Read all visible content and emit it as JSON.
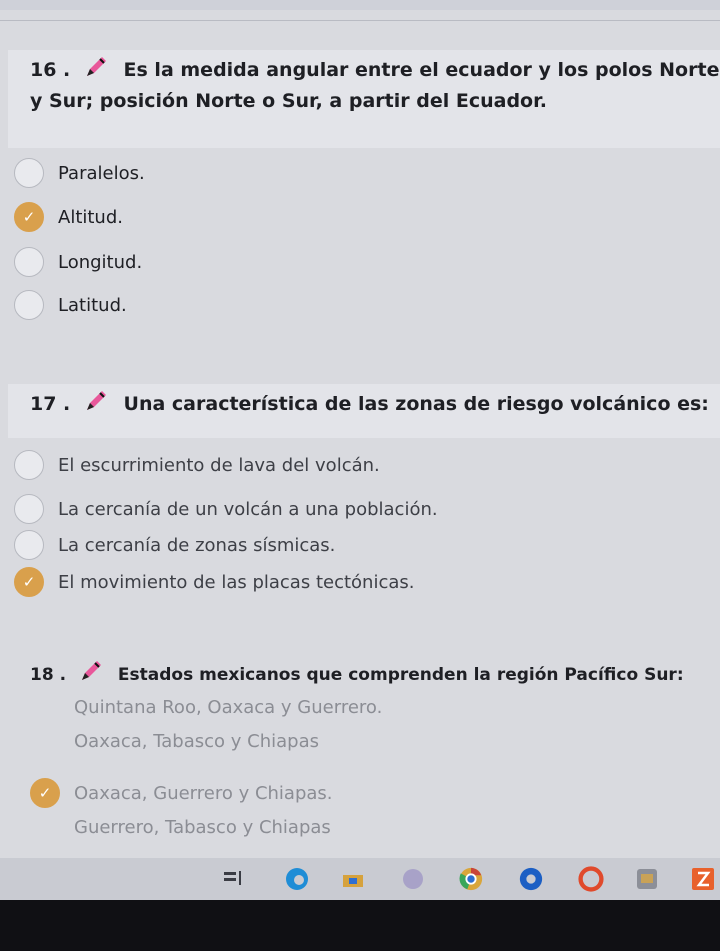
{
  "questions": [
    {
      "number": "16 .",
      "text": "Es la medida angular entre el ecuador y los polos Norte y Sur; posición Norte o Sur, a partir del Ecuador.",
      "options": [
        {
          "label": "Paralelos.",
          "checked": false
        },
        {
          "label": "Altitud.",
          "checked": true
        },
        {
          "label": "Longitud.",
          "checked": false
        },
        {
          "label": "Latitud.",
          "checked": false
        }
      ]
    },
    {
      "number": "17 .",
      "text": "Una característica de las zonas de riesgo volcánico es:",
      "options": [
        {
          "label": "El escurrimiento de lava del volcán.",
          "checked": false
        },
        {
          "label": "La cercanía de un volcán a una población.",
          "checked": false
        },
        {
          "label": "La cercanía de zonas sísmicas.",
          "checked": false
        },
        {
          "label": "El movimiento de las placas tectónicas.",
          "checked": true
        }
      ]
    },
    {
      "number": "18 .",
      "text": "Estados mexicanos que comprenden la región Pacífico Sur:",
      "options": [
        {
          "label": "Quintana Roo, Oaxaca y Guerrero.",
          "checked": false
        },
        {
          "label": "Oaxaca, Tabasco y Chiapas",
          "checked": false
        },
        {
          "label": "Oaxaca, Guerrero y Chiapas.",
          "checked": true
        },
        {
          "label": "Guerrero, Tabasco y Chiapas",
          "checked": false
        }
      ]
    }
  ],
  "icons": {
    "pencil": "pencil-icon",
    "check": "check-icon",
    "accent": "#d9a04c"
  },
  "taskbar": {
    "items": [
      "task-view-icon",
      "edge-icon",
      "store-icon",
      "app-icon",
      "chrome-icon",
      "app-blue-icon",
      "app-red-icon",
      "app-gray-icon",
      "app-orange-icon"
    ]
  }
}
